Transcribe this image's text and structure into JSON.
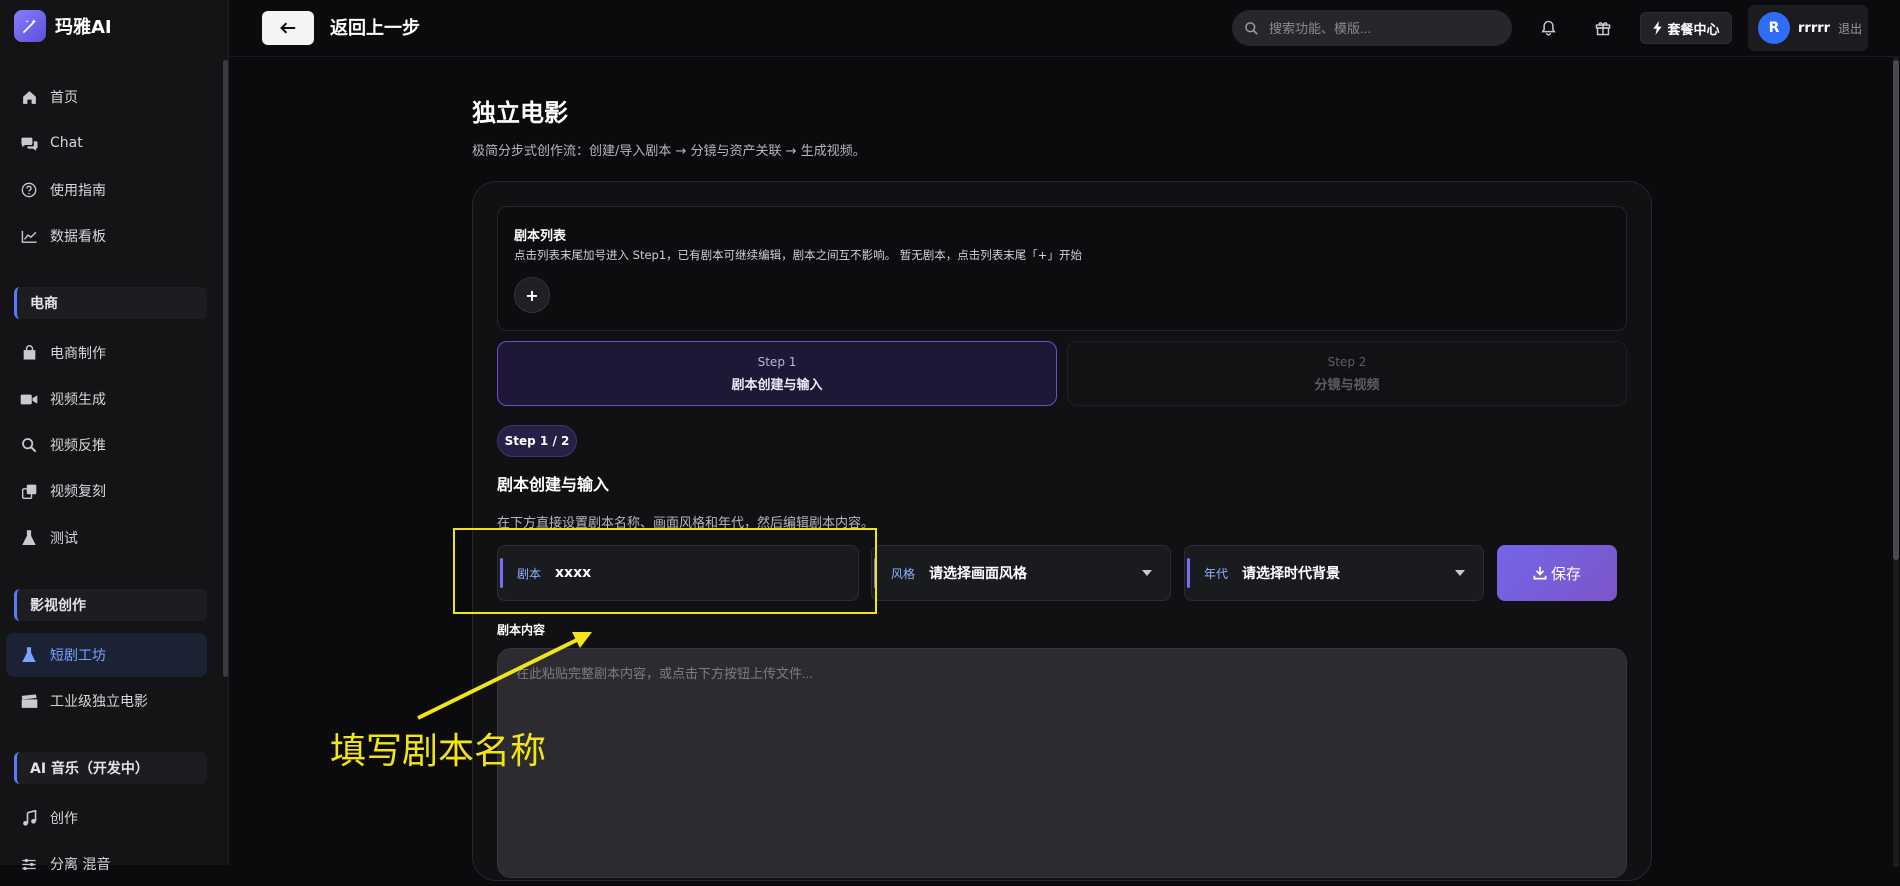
{
  "brand": {
    "name": "玛雅AI"
  },
  "sidebar": {
    "items": [
      {
        "label": "首页",
        "icon": "home-icon"
      },
      {
        "label": "Chat",
        "icon": "chat-icon"
      },
      {
        "label": "使用指南",
        "icon": "help-circle-icon"
      },
      {
        "label": "数据看板",
        "icon": "chart-line-icon"
      }
    ],
    "sections": [
      {
        "title": "电商",
        "items": [
          {
            "label": "电商制作",
            "icon": "shopping-bag-icon"
          },
          {
            "label": "视频生成",
            "icon": "video-camera-icon"
          },
          {
            "label": "视频反推",
            "icon": "search-magnify-icon"
          },
          {
            "label": "视频复刻",
            "icon": "copy-icon"
          },
          {
            "label": "测试",
            "icon": "flask-icon"
          }
        ]
      },
      {
        "title": "影视创作",
        "items": [
          {
            "label": "短剧工坊",
            "icon": "flask-icon",
            "active": true
          },
          {
            "label": "工业级独立电影",
            "icon": "clapperboard-icon"
          }
        ]
      },
      {
        "title": "AI 音乐（开发中）",
        "items": [
          {
            "label": "创作",
            "icon": "music-note-icon"
          },
          {
            "label": "分离 混音",
            "icon": "sliders-icon"
          }
        ]
      }
    ]
  },
  "header": {
    "back_label": "返回上一步",
    "search_placeholder": "搜索功能、模版...",
    "plan_label": "套餐中心",
    "user": {
      "avatar_letter": "R",
      "name": "rrrrr",
      "logout": "退出"
    }
  },
  "main": {
    "title": "独立电影",
    "subtitle": "极简分步式创作流：创建/导入剧本 → 分镜与资产关联 → 生成视频。",
    "script_list": {
      "title": "剧本列表",
      "desc": "点击列表末尾加号进入 Step1，已有剧本可继续编辑，剧本之间互不影响。  暂无剧本，点击列表末尾「+」开始",
      "add_label": "+"
    },
    "steps": [
      {
        "num": "Step 1",
        "title": "剧本创建与输入",
        "active": true
      },
      {
        "num": "Step 2",
        "title": "分镜与视频",
        "active": false
      }
    ],
    "step_badge": "Step 1 / 2",
    "section_title": "剧本创建与输入",
    "section_desc": "在下方直接设置剧本名称、画面风格和年代，然后编辑剧本内容。",
    "fields": {
      "name": {
        "label": "剧本",
        "value": "xxxx"
      },
      "style": {
        "label": "风格",
        "value": "请选择画面风格"
      },
      "era": {
        "label": "年代",
        "value": "请选择时代背景"
      }
    },
    "save_label": "保存",
    "content_label": "剧本内容",
    "content_placeholder": "在此粘贴完整剧本内容，或点击下方按钮上传文件..."
  },
  "annotation": {
    "text": "填写剧本名称",
    "color": "#f3e31a"
  },
  "colors": {
    "accent": "#7c6cf5",
    "active_nav": "#7aa2ff",
    "bg": "#0b0b0d"
  }
}
